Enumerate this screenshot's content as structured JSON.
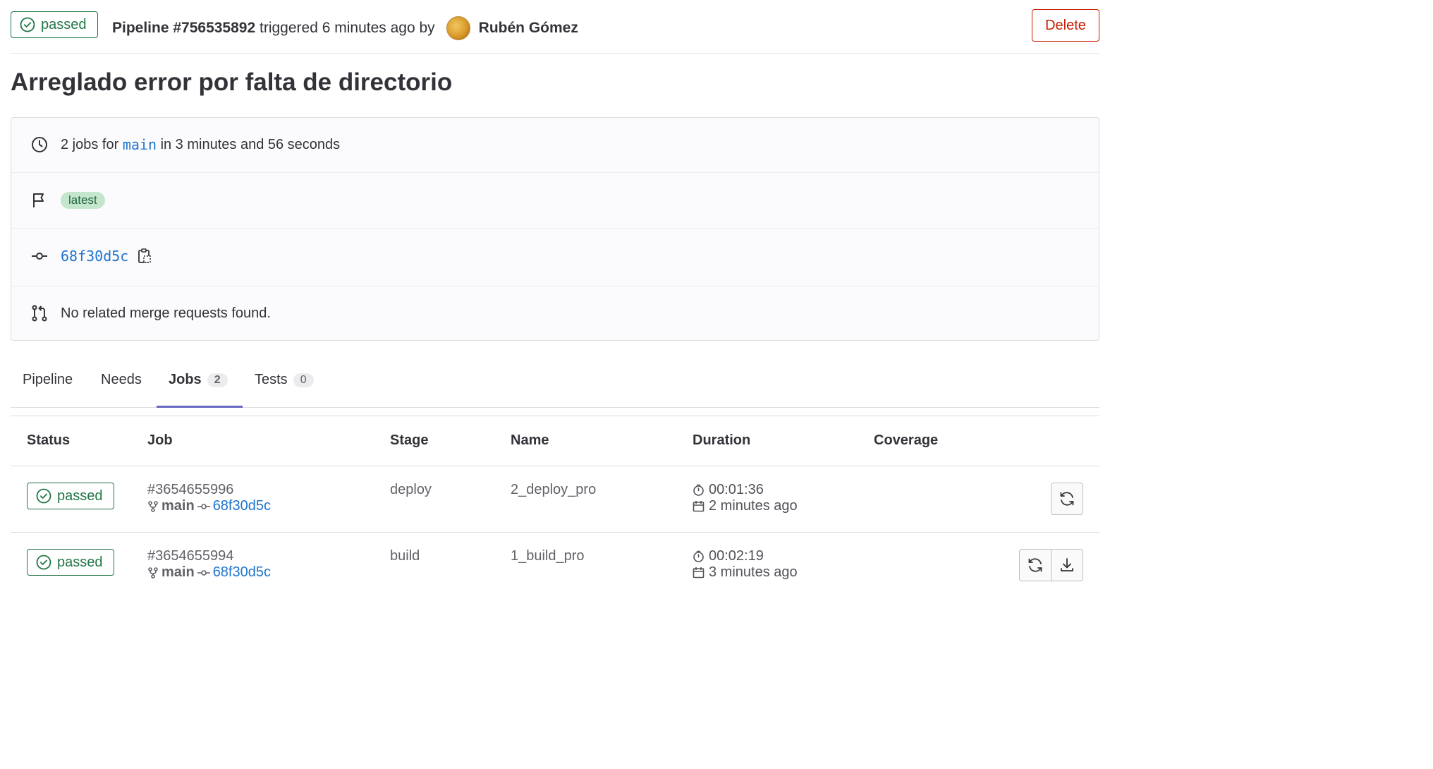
{
  "header": {
    "status": "passed",
    "pipeline_label": "Pipeline #756535892",
    "triggered_text": "triggered 6 minutes ago by",
    "user_name": "Rubén Gómez",
    "delete_label": "Delete"
  },
  "title": "Arreglado error por falta de directorio",
  "info": {
    "jobs_prefix": "2 jobs for",
    "branch": "main",
    "jobs_suffix": "in 3 minutes and 56 seconds",
    "tag": "latest",
    "commit": "68f30d5c",
    "merge_requests": "No related merge requests found."
  },
  "tabs": [
    {
      "label": "Pipeline"
    },
    {
      "label": "Needs"
    },
    {
      "label": "Jobs",
      "count": "2"
    },
    {
      "label": "Tests",
      "count": "0"
    }
  ],
  "table": {
    "headers": [
      "Status",
      "Job",
      "Stage",
      "Name",
      "Duration",
      "Coverage"
    ],
    "rows": [
      {
        "status": "passed",
        "job_id": "#3654655996",
        "branch": "main",
        "commit": "68f30d5c",
        "stage": "deploy",
        "name": "2_deploy_pro",
        "duration": "00:01:36",
        "finished": "2 minutes ago"
      },
      {
        "status": "passed",
        "job_id": "#3654655994",
        "branch": "main",
        "commit": "68f30d5c",
        "stage": "build",
        "name": "1_build_pro",
        "duration": "00:02:19",
        "finished": "3 minutes ago"
      }
    ]
  },
  "colors": {
    "success": "#217645",
    "danger": "#c91c00",
    "link": "#1f75cb",
    "tab_active": "#6666c4"
  }
}
